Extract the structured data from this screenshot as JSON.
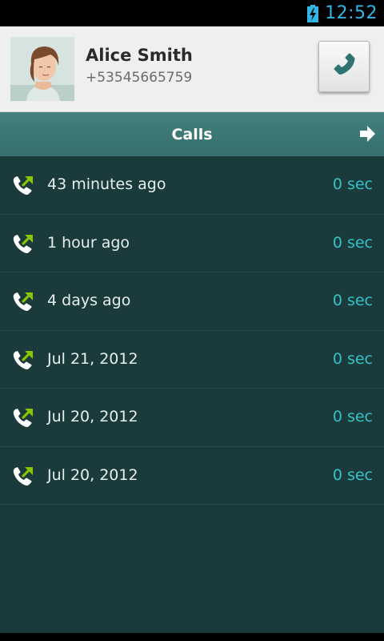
{
  "status_bar": {
    "time": "12:52",
    "battery_icon": "battery-charging-icon"
  },
  "contact": {
    "name": "Alice Smith",
    "number": "+53545665759",
    "call_button_icon": "phone-icon"
  },
  "tab": {
    "title": "Calls",
    "next_icon": "arrow-right-icon"
  },
  "calls": [
    {
      "time": "43 minutes ago",
      "duration": "0 sec",
      "icon": "outgoing-call-icon"
    },
    {
      "time": "1 hour ago",
      "duration": "0 sec",
      "icon": "outgoing-call-icon"
    },
    {
      "time": "4 days ago",
      "duration": "0 sec",
      "icon": "outgoing-call-icon"
    },
    {
      "time": "Jul 21, 2012",
      "duration": "0 sec",
      "icon": "outgoing-call-icon"
    },
    {
      "time": "Jul 20, 2012",
      "duration": "0 sec",
      "icon": "outgoing-call-icon"
    },
    {
      "time": "Jul 20, 2012",
      "duration": "0 sec",
      "icon": "outgoing-call-icon"
    }
  ],
  "colors": {
    "accent": "#33b5e5",
    "list_background": "#1a3a3b",
    "tab_background": "#3d7877",
    "duration_text": "#33c3c8",
    "outgoing_arrow": "#8bc400"
  }
}
